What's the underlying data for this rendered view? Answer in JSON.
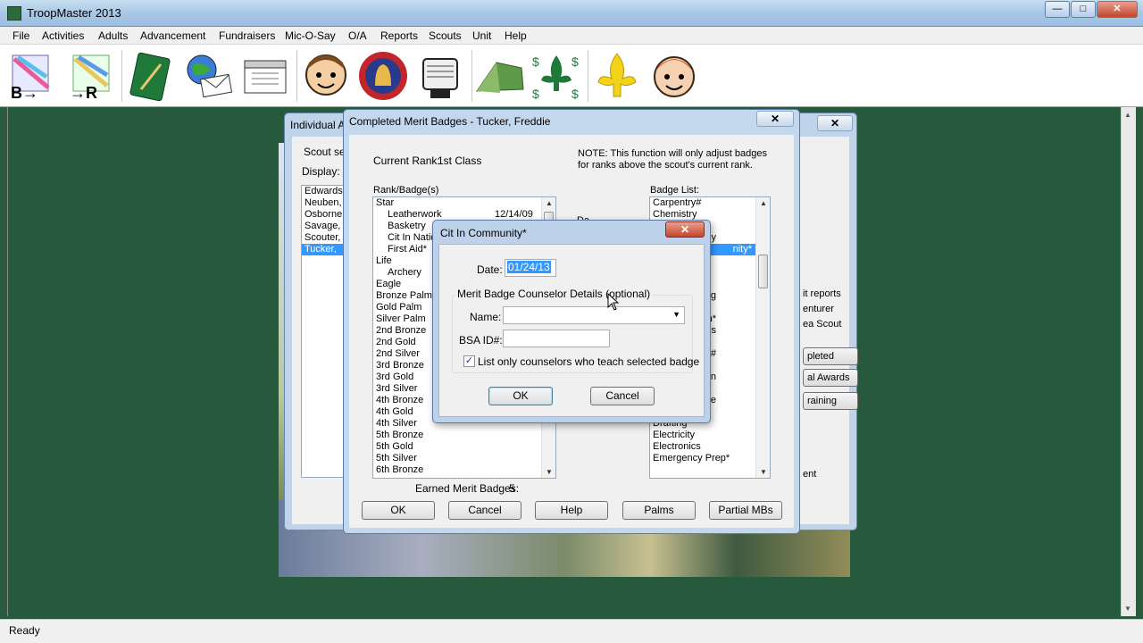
{
  "app": {
    "title": "TroopMaster 2013",
    "status": "Ready"
  },
  "window_buttons": {
    "minimize": "—",
    "maximize": "□",
    "close": "✕"
  },
  "menu": [
    "File",
    "Activities",
    "Adults",
    "Advancement",
    "Fundraisers",
    "Mic-O-Say",
    "O/A",
    "Reports",
    "Scouts",
    "Unit",
    "Help"
  ],
  "toolbar": [
    "b-to-r-icon",
    "r-icon",
    "notebook-icon",
    "globe-mail-icon",
    "calendar-icon",
    "boy-scout-icon",
    "liberty-bell-icon",
    "rolodex-icon",
    "tent-icon",
    "money-fleur-icon",
    "fleur-de-lis-icon",
    "cub-scout-icon"
  ],
  "individual": {
    "title": "Individual A",
    "close": "✕",
    "scout_select_label": "Scout sel",
    "display_label": "Display:",
    "heading_fragment": "U",
    "scouts": [
      "Edwards",
      "Neuben,",
      "Osborne,",
      "Savage,",
      "Scouter,",
      "Tucker,"
    ],
    "selected_scout": "Tucker,",
    "right_texts": [
      "it reports",
      "enturer",
      "ea Scout",
      "ent"
    ],
    "right_buttons": [
      "pleted",
      "al Awards",
      "raining"
    ]
  },
  "completed": {
    "title": "Completed Merit Badges - Tucker,  Freddie",
    "close": "✕",
    "current_rank_label": "Current Rank:",
    "current_rank": "1st Class",
    "note": [
      "NOTE:  This function will only adjust badges",
      "for ranks above the scout's current rank."
    ],
    "rank_badges_label": "Rank/Badge(s)",
    "rank_badges": [
      {
        "label": "Star",
        "indent": 0,
        "date": ""
      },
      {
        "label": "Leatherwork",
        "indent": 1,
        "date": "12/14/09"
      },
      {
        "label": "Basketry",
        "indent": 1,
        "date": ""
      },
      {
        "label": "Cit In Natio",
        "indent": 1,
        "date": ""
      },
      {
        "label": "First Aid*",
        "indent": 1,
        "date": ""
      },
      {
        "label": "Life",
        "indent": 0,
        "date": ""
      },
      {
        "label": "Archery",
        "indent": 1,
        "date": ""
      },
      {
        "label": "Eagle",
        "indent": 0,
        "date": ""
      },
      {
        "label": "Bronze Palm",
        "indent": 0,
        "date": ""
      },
      {
        "label": "Gold Palm",
        "indent": 0,
        "date": ""
      },
      {
        "label": "Silver Palm",
        "indent": 0,
        "date": ""
      },
      {
        "label": "2nd Bronze",
        "indent": 0,
        "date": ""
      },
      {
        "label": "2nd Gold",
        "indent": 0,
        "date": ""
      },
      {
        "label": "2nd Silver",
        "indent": 0,
        "date": ""
      },
      {
        "label": "3rd Bronze",
        "indent": 0,
        "date": ""
      },
      {
        "label": "3rd Gold",
        "indent": 0,
        "date": ""
      },
      {
        "label": "3rd Silver",
        "indent": 0,
        "date": ""
      },
      {
        "label": "4th Bronze",
        "indent": 0,
        "date": ""
      },
      {
        "label": "4th Gold",
        "indent": 0,
        "date": ""
      },
      {
        "label": "4th Silver",
        "indent": 0,
        "date": ""
      },
      {
        "label": "5th Bronze",
        "indent": 0,
        "date": ""
      },
      {
        "label": "5th Gold",
        "indent": 0,
        "date": ""
      },
      {
        "label": "5th Silver",
        "indent": 0,
        "date": ""
      },
      {
        "label": "6th Bronze",
        "indent": 0,
        "date": ""
      }
    ],
    "earned_label": "Earned Merit Badges:",
    "earned_count": "5",
    "date_fragment": "Da",
    "badge_list_label": "Badge List:",
    "badge_list": [
      {
        "label": "Carpentry#",
        "sel": false
      },
      {
        "label": "Chemistry",
        "sel": false
      },
      {
        "label": "",
        "sel": false
      },
      {
        "label": "hy",
        "sel": false
      },
      {
        "label": "nity*",
        "sel": true
      },
      {
        "label": "",
        "sel": false
      },
      {
        "label": "",
        "sel": false
      },
      {
        "label": "",
        "sel": false
      },
      {
        "label": "ng",
        "sel": false
      },
      {
        "label": "",
        "sel": false
      },
      {
        "label": "n*",
        "sel": false
      },
      {
        "label": "aterials",
        "sel": false
      },
      {
        "label": "",
        "sel": false
      },
      {
        "label": "ping#",
        "sel": false
      },
      {
        "label": "",
        "sel": false
      },
      {
        "label": "on",
        "sel": false
      },
      {
        "label": "",
        "sel": false
      },
      {
        "label": "re",
        "sel": false
      },
      {
        "label": "Dog Care",
        "sel": false
      },
      {
        "label": "Drafting",
        "sel": false
      },
      {
        "label": "Electricity",
        "sel": false
      },
      {
        "label": "Electronics",
        "sel": false
      },
      {
        "label": "Emergency Prep*",
        "sel": false
      }
    ],
    "buttons": [
      "OK",
      "Cancel",
      "Help",
      "Palms",
      "Partial MBs"
    ]
  },
  "cit": {
    "title": "Cit In Community*",
    "close": "✕",
    "date_label": "Date:",
    "date_value": "01/24/13",
    "group_label": "Merit Badge Counselor Details (optional)",
    "name_label": "Name:",
    "name_value": "",
    "bsa_label": "BSA ID#:",
    "bsa_value": "",
    "checkbox_label": "List only counselors who teach selected badge",
    "checkbox_checked": true,
    "ok": "OK",
    "cancel": "Cancel"
  }
}
